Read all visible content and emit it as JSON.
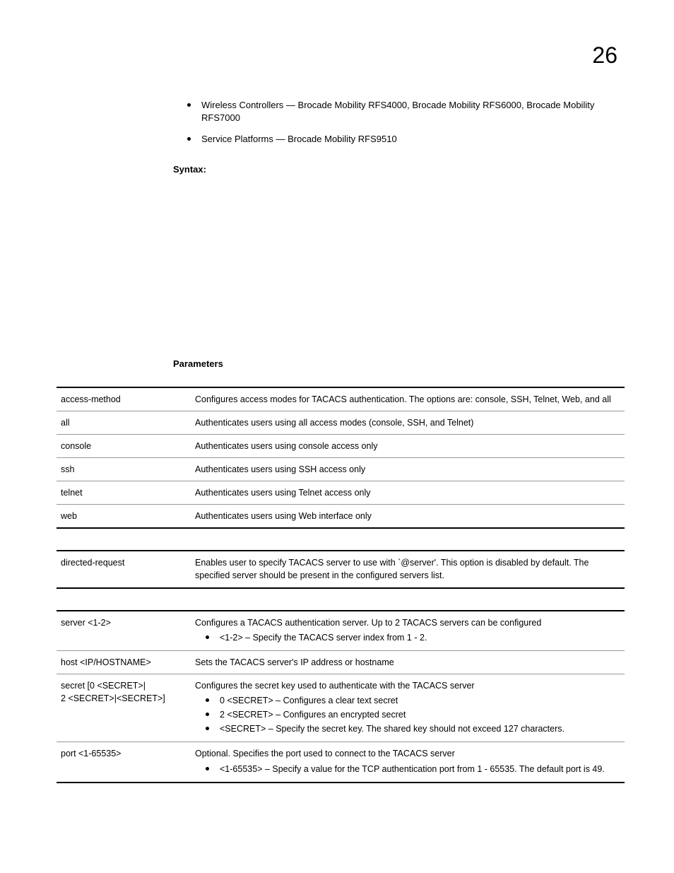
{
  "pageNumber": "26",
  "topBullets": [
    "Wireless Controllers — Brocade Mobility RFS4000, Brocade Mobility RFS6000, Brocade Mobility RFS7000",
    "Service Platforms — Brocade Mobility RFS9510"
  ],
  "headings": {
    "syntax": "Syntax:",
    "parameters": "Parameters"
  },
  "table1": [
    {
      "param": "access-method",
      "desc": "Configures access modes for TACACS authentication. The options are: console, SSH, Telnet, Web, and all"
    },
    {
      "param": "all",
      "desc": "Authenticates users using all access modes (console, SSH, and Telnet)"
    },
    {
      "param": "console",
      "desc": "Authenticates users using console access only"
    },
    {
      "param": "ssh",
      "desc": "Authenticates users using SSH access only"
    },
    {
      "param": "telnet",
      "desc": "Authenticates users using Telnet access only"
    },
    {
      "param": "web",
      "desc": "Authenticates users using Web interface only"
    }
  ],
  "table2": [
    {
      "param": "directed-request",
      "desc": "Enables user to specify TACACS server to use with `@server'. This option is disabled by default. The specified server should be present in the configured servers list."
    }
  ],
  "table3": [
    {
      "param": "server <1-2>",
      "desc": "Configures a TACACS authentication server. Up to 2 TACACS servers can be configured",
      "bullets": [
        "<1-2> – Specify the TACACS server index from 1 - 2."
      ]
    },
    {
      "param": "host <IP/HOSTNAME>",
      "desc": "Sets the TACACS server's IP address or hostname"
    },
    {
      "param": "secret [0 <SECRET>|\n2 <SECRET>|<SECRET>]",
      "desc": "Configures the secret key used to authenticate with the TACACS server",
      "bullets": [
        "0 <SECRET> – Configures a clear text secret",
        "2 <SECRET> – Configures an encrypted secret",
        "<SECRET> – Specify the secret key. The shared key should not exceed 127 characters."
      ]
    },
    {
      "param": "port <1-65535>",
      "desc": "Optional. Specifies the port used to connect to the TACACS server",
      "bullets": [
        "<1-65535> – Specify a value for the TCP authentication port from 1 - 65535. The default port is 49."
      ]
    }
  ]
}
